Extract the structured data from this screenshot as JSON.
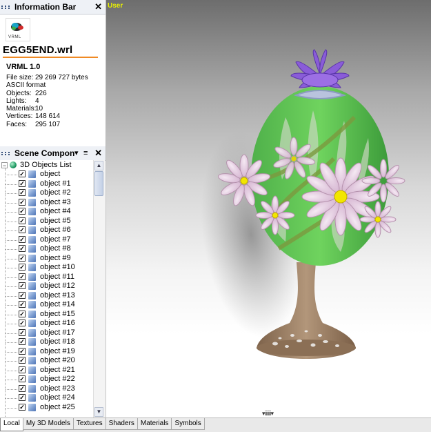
{
  "info_panel": {
    "title": "Information Bar",
    "close": "✕",
    "logo_text": "VRML",
    "filename": "EGG5END.wrl",
    "version": "VRML 1.0",
    "properties": [
      {
        "key": "File size:",
        "value": "29 269 727 bytes"
      },
      {
        "key": "ASCII format",
        "value": ""
      },
      {
        "key": "Objects:",
        "value": "226"
      },
      {
        "key": "Lights:",
        "value": "4"
      },
      {
        "key": "Materials:",
        "value": "10"
      },
      {
        "key": "Vertices:",
        "value": "148 614"
      },
      {
        "key": "Faces:",
        "value": "295 107"
      }
    ]
  },
  "scene_panel": {
    "title": "Scene Compone",
    "dropdown": "▾",
    "menu": "≡",
    "close": "✕",
    "root_label": "3D Objects List",
    "root_expander": "−",
    "items": [
      "object",
      "object #1",
      "object #2",
      "object #3",
      "object #4",
      "object #5",
      "object #6",
      "object #7",
      "object #8",
      "object #9",
      "object #10",
      "object #11",
      "object #12",
      "object #13",
      "object #14",
      "object #15",
      "object #16",
      "object #17",
      "object #18",
      "object #19",
      "object #20",
      "object #21",
      "object #22",
      "object #23",
      "object #24",
      "object #25"
    ],
    "check": "✓",
    "scroll_up": "▲",
    "scroll_down": "▼"
  },
  "viewport": {
    "camera_label": "User",
    "bottom_marker": "▾ⅰⅰⅰⅰⅰⅰ▾"
  },
  "tabs": [
    {
      "label": "Local",
      "active": true
    },
    {
      "label": "My 3D Models",
      "active": false
    },
    {
      "label": "Textures",
      "active": false
    },
    {
      "label": "Shaders",
      "active": false
    },
    {
      "label": "Materials",
      "active": false
    },
    {
      "label": "Symbols",
      "active": false
    }
  ],
  "colors": {
    "accent_rule": "#f08a24",
    "camera_label": "#e8f000",
    "petal_purple": "#8a5cd8",
    "leaf_green": "#3fb04a",
    "base_bronze": "#9b7e62"
  }
}
